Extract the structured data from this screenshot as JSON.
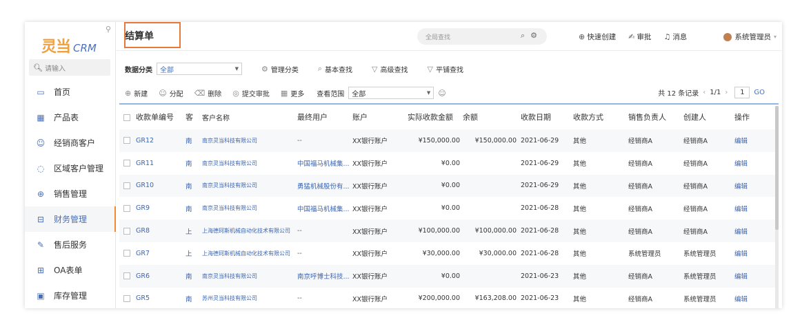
{
  "app": {
    "logo_cn": "灵当",
    "logo_en": "CRM"
  },
  "sidebar": {
    "search_placeholder": "请输入",
    "items": [
      {
        "label": "首页",
        "icon": "monitor-icon"
      },
      {
        "label": "产品表",
        "icon": "grid-icon"
      },
      {
        "label": "经销商客户",
        "icon": "person-icon"
      },
      {
        "label": "区域客户管理",
        "icon": "chat-icon"
      },
      {
        "label": "销售管理",
        "icon": "target-icon"
      },
      {
        "label": "财务管理",
        "icon": "finance-icon",
        "active": true
      },
      {
        "label": "售后服务",
        "icon": "wrench-icon"
      },
      {
        "label": "OA表单",
        "icon": "form-icon"
      },
      {
        "label": "库存管理",
        "icon": "box-icon"
      }
    ]
  },
  "header": {
    "title": "结算单",
    "search_placeholder": "全局查找",
    "quick_create": "快速创建",
    "approval": "审批",
    "messages": "消息",
    "user": "系统管理员"
  },
  "toolbar": {
    "category_label": "数据分类",
    "category_value": "全部",
    "manage_category": "管理分类",
    "basic_search": "基本查找",
    "advanced_search": "高级查找",
    "tile_search": "平铺查找",
    "new": "新建",
    "assign": "分配",
    "delete": "删除",
    "submit_approval": "提交审批",
    "more": "更多",
    "view_scope_label": "查看范围",
    "view_scope_value": "全部"
  },
  "pager": {
    "total": "共 12 条记录",
    "pages": "1/1",
    "page": "1",
    "go": "GO"
  },
  "table": {
    "headers": [
      "收款单编号",
      "客",
      "客户名称",
      "最终用户",
      "账户",
      "实际收款金额",
      "余额",
      "收款日期",
      "收款方式",
      "销售负责人",
      "创建人",
      "操作"
    ],
    "rows": [
      {
        "no": "GR12",
        "cust_short": "南",
        "customer": "南京灵当科技有限公司",
        "end_user": "--",
        "account": "XX银行账户",
        "amount": "¥150,000.00",
        "balance": "¥150,000.00",
        "date": "2021-06-29",
        "method": "其他",
        "sales": "经销商A",
        "creator": "经销商A",
        "op": "编辑"
      },
      {
        "no": "GR11",
        "cust_short": "南",
        "customer": "南京灵当科技有限公司",
        "end_user": "中国福马机械集...",
        "account": "XX银行账户",
        "amount": "¥0.00",
        "balance": "",
        "date": "2021-06-29",
        "method": "其他",
        "sales": "经销商A",
        "creator": "经销商A",
        "op": "编辑"
      },
      {
        "no": "GR10",
        "cust_short": "南",
        "customer": "南京灵当科技有限公司",
        "end_user": "勇猛机械股份有...",
        "account": "XX银行账户",
        "amount": "¥0.00",
        "balance": "",
        "date": "2021-06-29",
        "method": "其他",
        "sales": "经销商A",
        "creator": "经销商A",
        "op": "编辑"
      },
      {
        "no": "GR9",
        "cust_short": "南",
        "customer": "南京灵当科技有限公司",
        "end_user": "中国福马机械集...",
        "account": "XX银行账户",
        "amount": "¥0.00",
        "balance": "",
        "date": "2021-06-28",
        "method": "其他",
        "sales": "经销商A",
        "creator": "经销商A",
        "op": "编辑"
      },
      {
        "no": "GR8",
        "cust_short": "上",
        "customer": "上海德珂斯机械自动化技术有限公司",
        "end_user": "--",
        "account": "XX银行账户",
        "amount": "¥100,000.00",
        "balance": "¥100,000.00",
        "date": "2021-06-28",
        "method": "其他",
        "sales": "经销商A",
        "creator": "经销商A",
        "op": "编辑"
      },
      {
        "no": "GR7",
        "cust_short": "上",
        "customer": "上海德珂斯机械自动化技术有限公司",
        "end_user": "--",
        "account": "XX银行账户",
        "amount": "¥30,000.00",
        "balance": "¥30,000.00",
        "date": "2021-06-28",
        "method": "其他",
        "sales": "系统管理员",
        "creator": "系统管理员",
        "op": "编辑"
      },
      {
        "no": "GR6",
        "cust_short": "南",
        "customer": "南京灵当科技有限公司",
        "end_user": "南京呼博士科技...",
        "account": "XX银行账户",
        "amount": "¥0.00",
        "balance": "",
        "date": "2021-06-23",
        "method": "其他",
        "sales": "经销商A",
        "creator": "系统管理员",
        "op": "编辑"
      },
      {
        "no": "GR5",
        "cust_short": "南",
        "customer": "苏州灵当科技有限公司",
        "end_user": "--",
        "account": "XX银行账户",
        "amount": "¥200,000.00",
        "balance": "¥163,208.00",
        "date": "2021-06-23",
        "method": "其他",
        "sales": "经销商A",
        "creator": "系统管理员",
        "op": "编辑"
      }
    ]
  },
  "colors": {
    "accent": "#4a6fb5",
    "highlight": "#e8773a",
    "logo": "#f0a040"
  }
}
